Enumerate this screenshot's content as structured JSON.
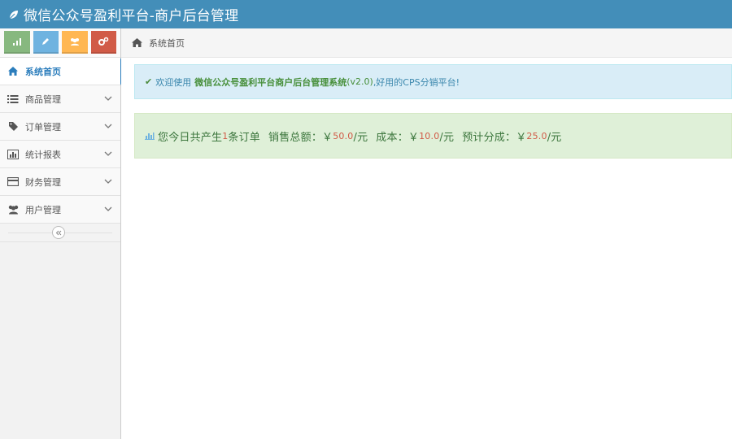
{
  "header": {
    "title": "微信公众号盈利平台-商户后台管理",
    "brand_icon": "leaf-icon"
  },
  "colors": {
    "navbar": "#438eb9",
    "shortcut_green": "#87b87f",
    "shortcut_blue": "#6fb3e0",
    "shortcut_orange": "#ffb752",
    "shortcut_red": "#d15b47",
    "accent": "#2b7dbc"
  },
  "sidebar": {
    "shortcuts": [
      {
        "icon": "signal-icon",
        "color": "#87b87f"
      },
      {
        "icon": "pencil-icon",
        "color": "#6fb3e0"
      },
      {
        "icon": "users-icon",
        "color": "#ffb752"
      },
      {
        "icon": "cogs-icon",
        "color": "#d15b47"
      }
    ],
    "items": [
      {
        "label": "系统首页",
        "icon": "home-icon",
        "active": true
      },
      {
        "label": "商品管理",
        "icon": "list-icon",
        "active": false
      },
      {
        "label": "订单管理",
        "icon": "tag-icon",
        "active": false
      },
      {
        "label": "统计报表",
        "icon": "bar-chart-icon",
        "active": false
      },
      {
        "label": "财务管理",
        "icon": "credit-card-icon",
        "active": false
      },
      {
        "label": "用户管理",
        "icon": "users-icon",
        "active": false
      }
    ],
    "collapse_icon": "double-angle-left-icon"
  },
  "breadcrumb": {
    "home_label": "系统首页"
  },
  "welcome": {
    "prefix": "欢迎使用",
    "system_name": "微信公众号盈利平台商户后台管理系统",
    "version": "(v2.0)",
    "suffix": ",好用的CPS分销平台!"
  },
  "stats": {
    "intro": "您今日共产生",
    "order_count": "1",
    "order_unit": "条订单",
    "sales_label": "销售总额：￥",
    "sales_value": "50.0",
    "sales_unit": "/元",
    "cost_label": "成本：￥",
    "cost_value": "10.0",
    "cost_unit": "/元",
    "share_label": "预计分成：￥",
    "share_value": "25.0",
    "share_unit": "/元"
  }
}
